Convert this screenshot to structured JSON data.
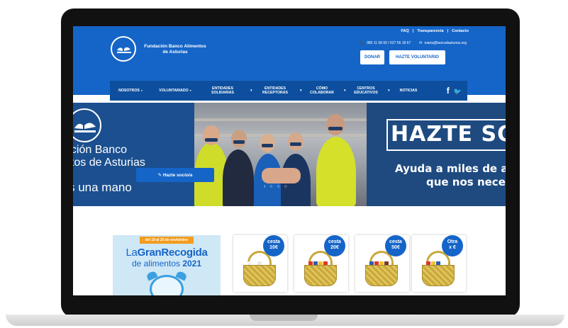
{
  "site": {
    "logo_text_line1": "Fundación Banco Alimentos",
    "logo_text_line2": "de Asturias"
  },
  "top_links": {
    "faq": "FAQ",
    "transparencia": "Transparencia",
    "contacto": "Contacto",
    "separator": "|"
  },
  "contact": {
    "phone": "985 11 58 60 / 627 56 18 67",
    "email": "maria@bancaliasturias.org"
  },
  "buttons": {
    "donar": "DONAR",
    "hazte_voluntario": "HAZTE VOLUNTARIO"
  },
  "nav": {
    "items": [
      {
        "line1": "NOSOTROS",
        "line2": "",
        "caret": "▾"
      },
      {
        "line1": "VOLUNTARIADO",
        "line2": "",
        "caret": "▾"
      },
      {
        "line1": "ENTIDADES",
        "line2": "SOLIDARIAS",
        "caret": "▾"
      },
      {
        "line1": "ENTIDADES",
        "line2": "RECEPTORAS",
        "caret": "▾"
      },
      {
        "line1": "CÓMO",
        "line2": "COLABORAR",
        "caret": "▾"
      },
      {
        "line1": "CENTROS",
        "line2": "EDUCATIVOS",
        "caret": "▾"
      },
      {
        "line1": "NOTICIAS",
        "line2": "",
        "caret": ""
      }
    ],
    "social_facebook": "f",
    "social_twitter": "🐦"
  },
  "hero": {
    "left_line1": "ación Banco",
    "left_line2": "ntos de Asturias",
    "left_line3": "s una mano",
    "cta": "✎ Hazte socio/a",
    "dots": "› ○ ○ ○",
    "right_title": "HAZTE SO",
    "right_line1": "Ayuda a miles de a",
    "right_line2": "que nos nece"
  },
  "promo": {
    "tag": "del 19 al 25 de noviembre",
    "title_a": "La",
    "title_b": "GranRecogida",
    "sub_a": "de alimentos ",
    "sub_b": "2021"
  },
  "cestas": [
    {
      "line1": "cesta",
      "line2": "10€"
    },
    {
      "line1": "cesta",
      "line2": "20€"
    },
    {
      "line1": "cesta",
      "line2": "50€"
    },
    {
      "line1": "Otra",
      "line2": "x €"
    }
  ],
  "colors": {
    "brand_blue": "#1565c8",
    "nav_blue": "#0d4f9e",
    "promo_orange": "#f39c1f"
  }
}
